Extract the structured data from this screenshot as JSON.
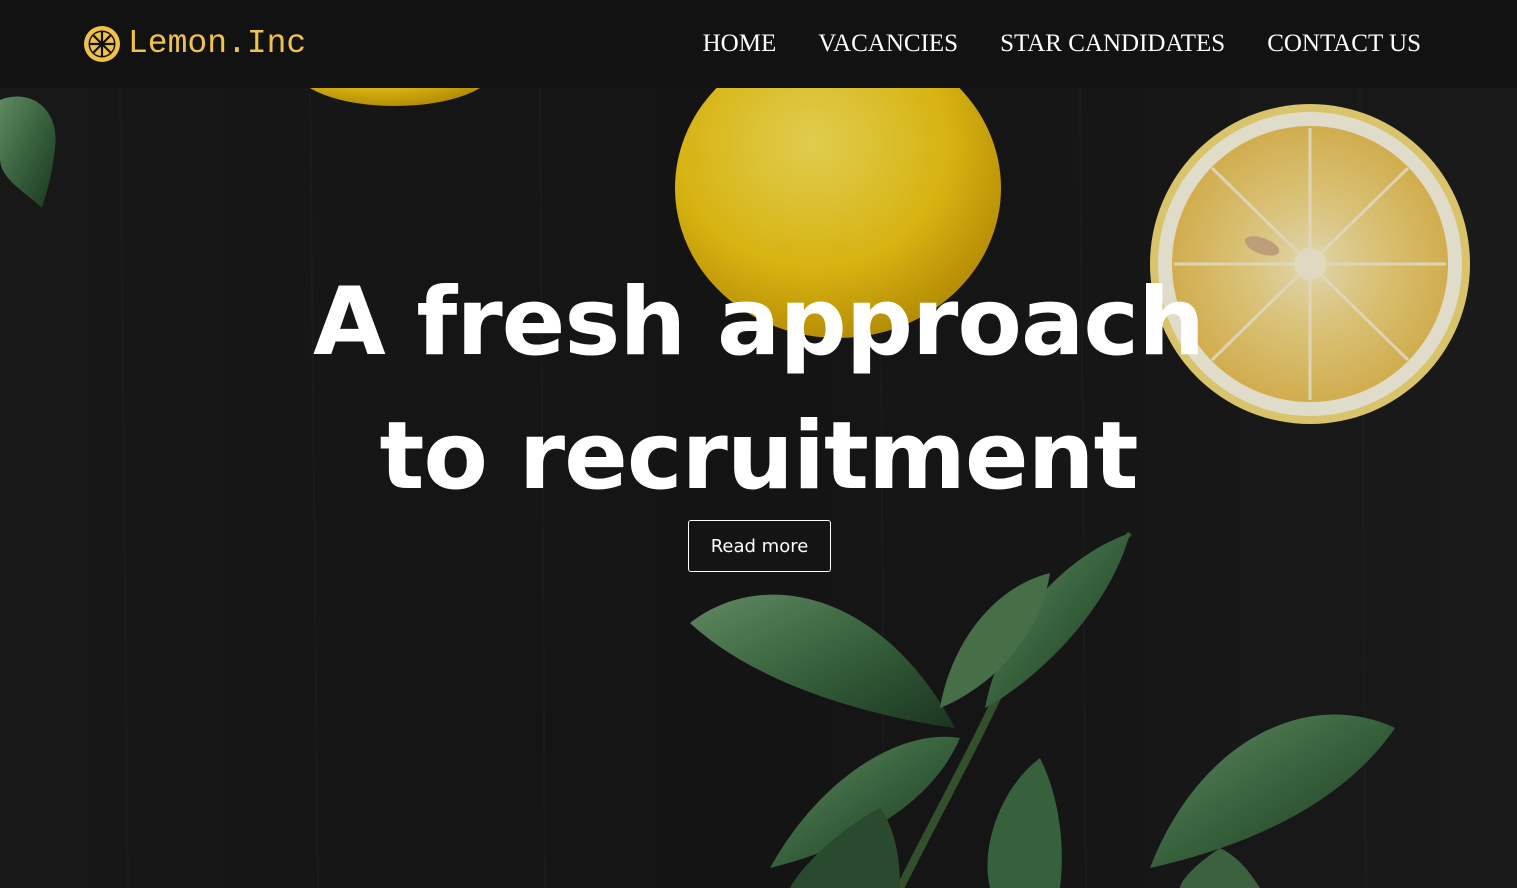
{
  "brand": {
    "name": "Lemon.Inc",
    "icon": "lemon-slice-icon",
    "color": "#f0c14b"
  },
  "nav": {
    "items": [
      {
        "label": "HOME"
      },
      {
        "label": "VACANCIES"
      },
      {
        "label": "STAR CANDIDATES"
      },
      {
        "label": "CONTACT US"
      }
    ]
  },
  "hero": {
    "title_line1": "A fresh approach",
    "title_line2": "to recruitment",
    "button_label": "Read more",
    "background": "lemons-and-leaves-on-dark-wood"
  }
}
